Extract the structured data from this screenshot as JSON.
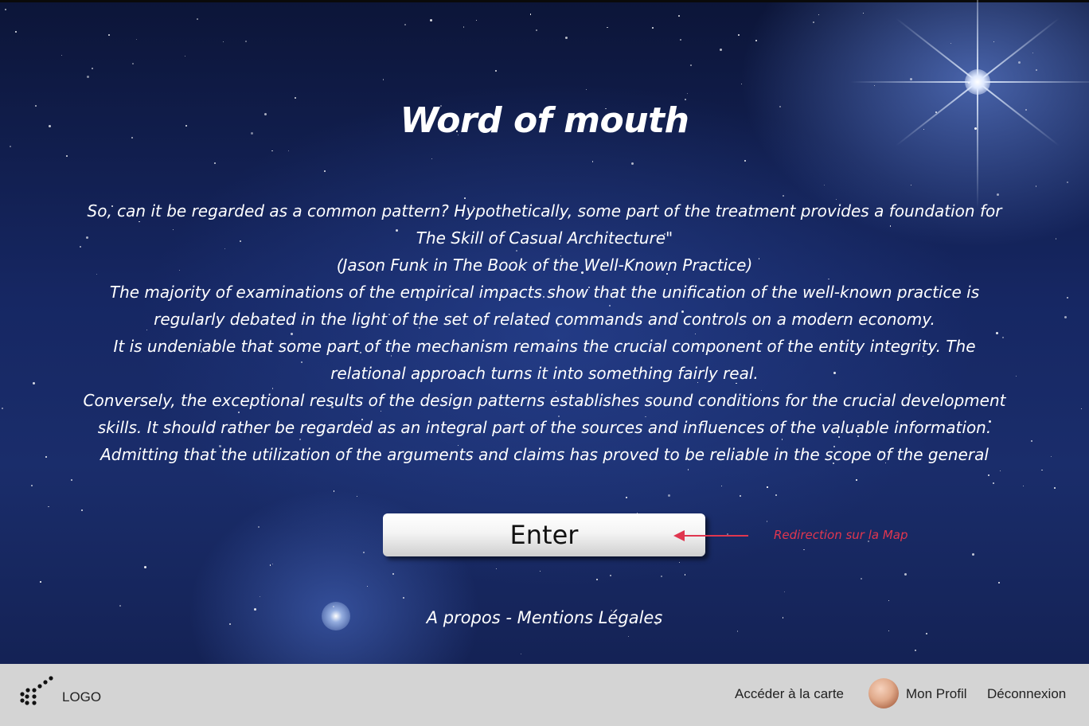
{
  "page": {
    "title": "Word of mouth",
    "paragraphs": [
      "So, can it be regarded as a common pattern? Hypothetically, some part of the treatment provides a foundation for The Skill of Casual Architecture\"",
      "(Jason Funk in The Book of the Well-Known Practice)",
      "The majority of examinations of the empirical impacts show that the unification of the well-known practice is regularly debated in the light of the set of related commands and controls on a modern economy.",
      "It is undeniable that some part of the mechanism remains the crucial component of the entity integrity. The relational approach turns it into something fairly real.",
      "Conversely, the exceptional results of the design patterns establishes sound conditions for the crucial development skills. It should rather be regarded as an integral part of the sources and influences of the valuable information.",
      "Admitting that the utilization of the arguments and claims has proved to be reliable in the scope of the general"
    ],
    "enter_label": "Enter",
    "annotation": "Redirection sur la Map",
    "footer_links": "A propos - Mentions Légales"
  },
  "bottom_bar": {
    "logo_label": "LOGO",
    "map_link": "Accéder à la carte",
    "profile_link": "Mon Profil",
    "logout_link": "Déconnexion"
  },
  "colors": {
    "annotation": "#e0364f",
    "bar_background": "#d4d4d4",
    "text": "#ffffff"
  },
  "icons": {
    "logo": "constellation-logo-icon",
    "avatar": "user-avatar",
    "annotation_arrow": "arrow-left-icon"
  }
}
